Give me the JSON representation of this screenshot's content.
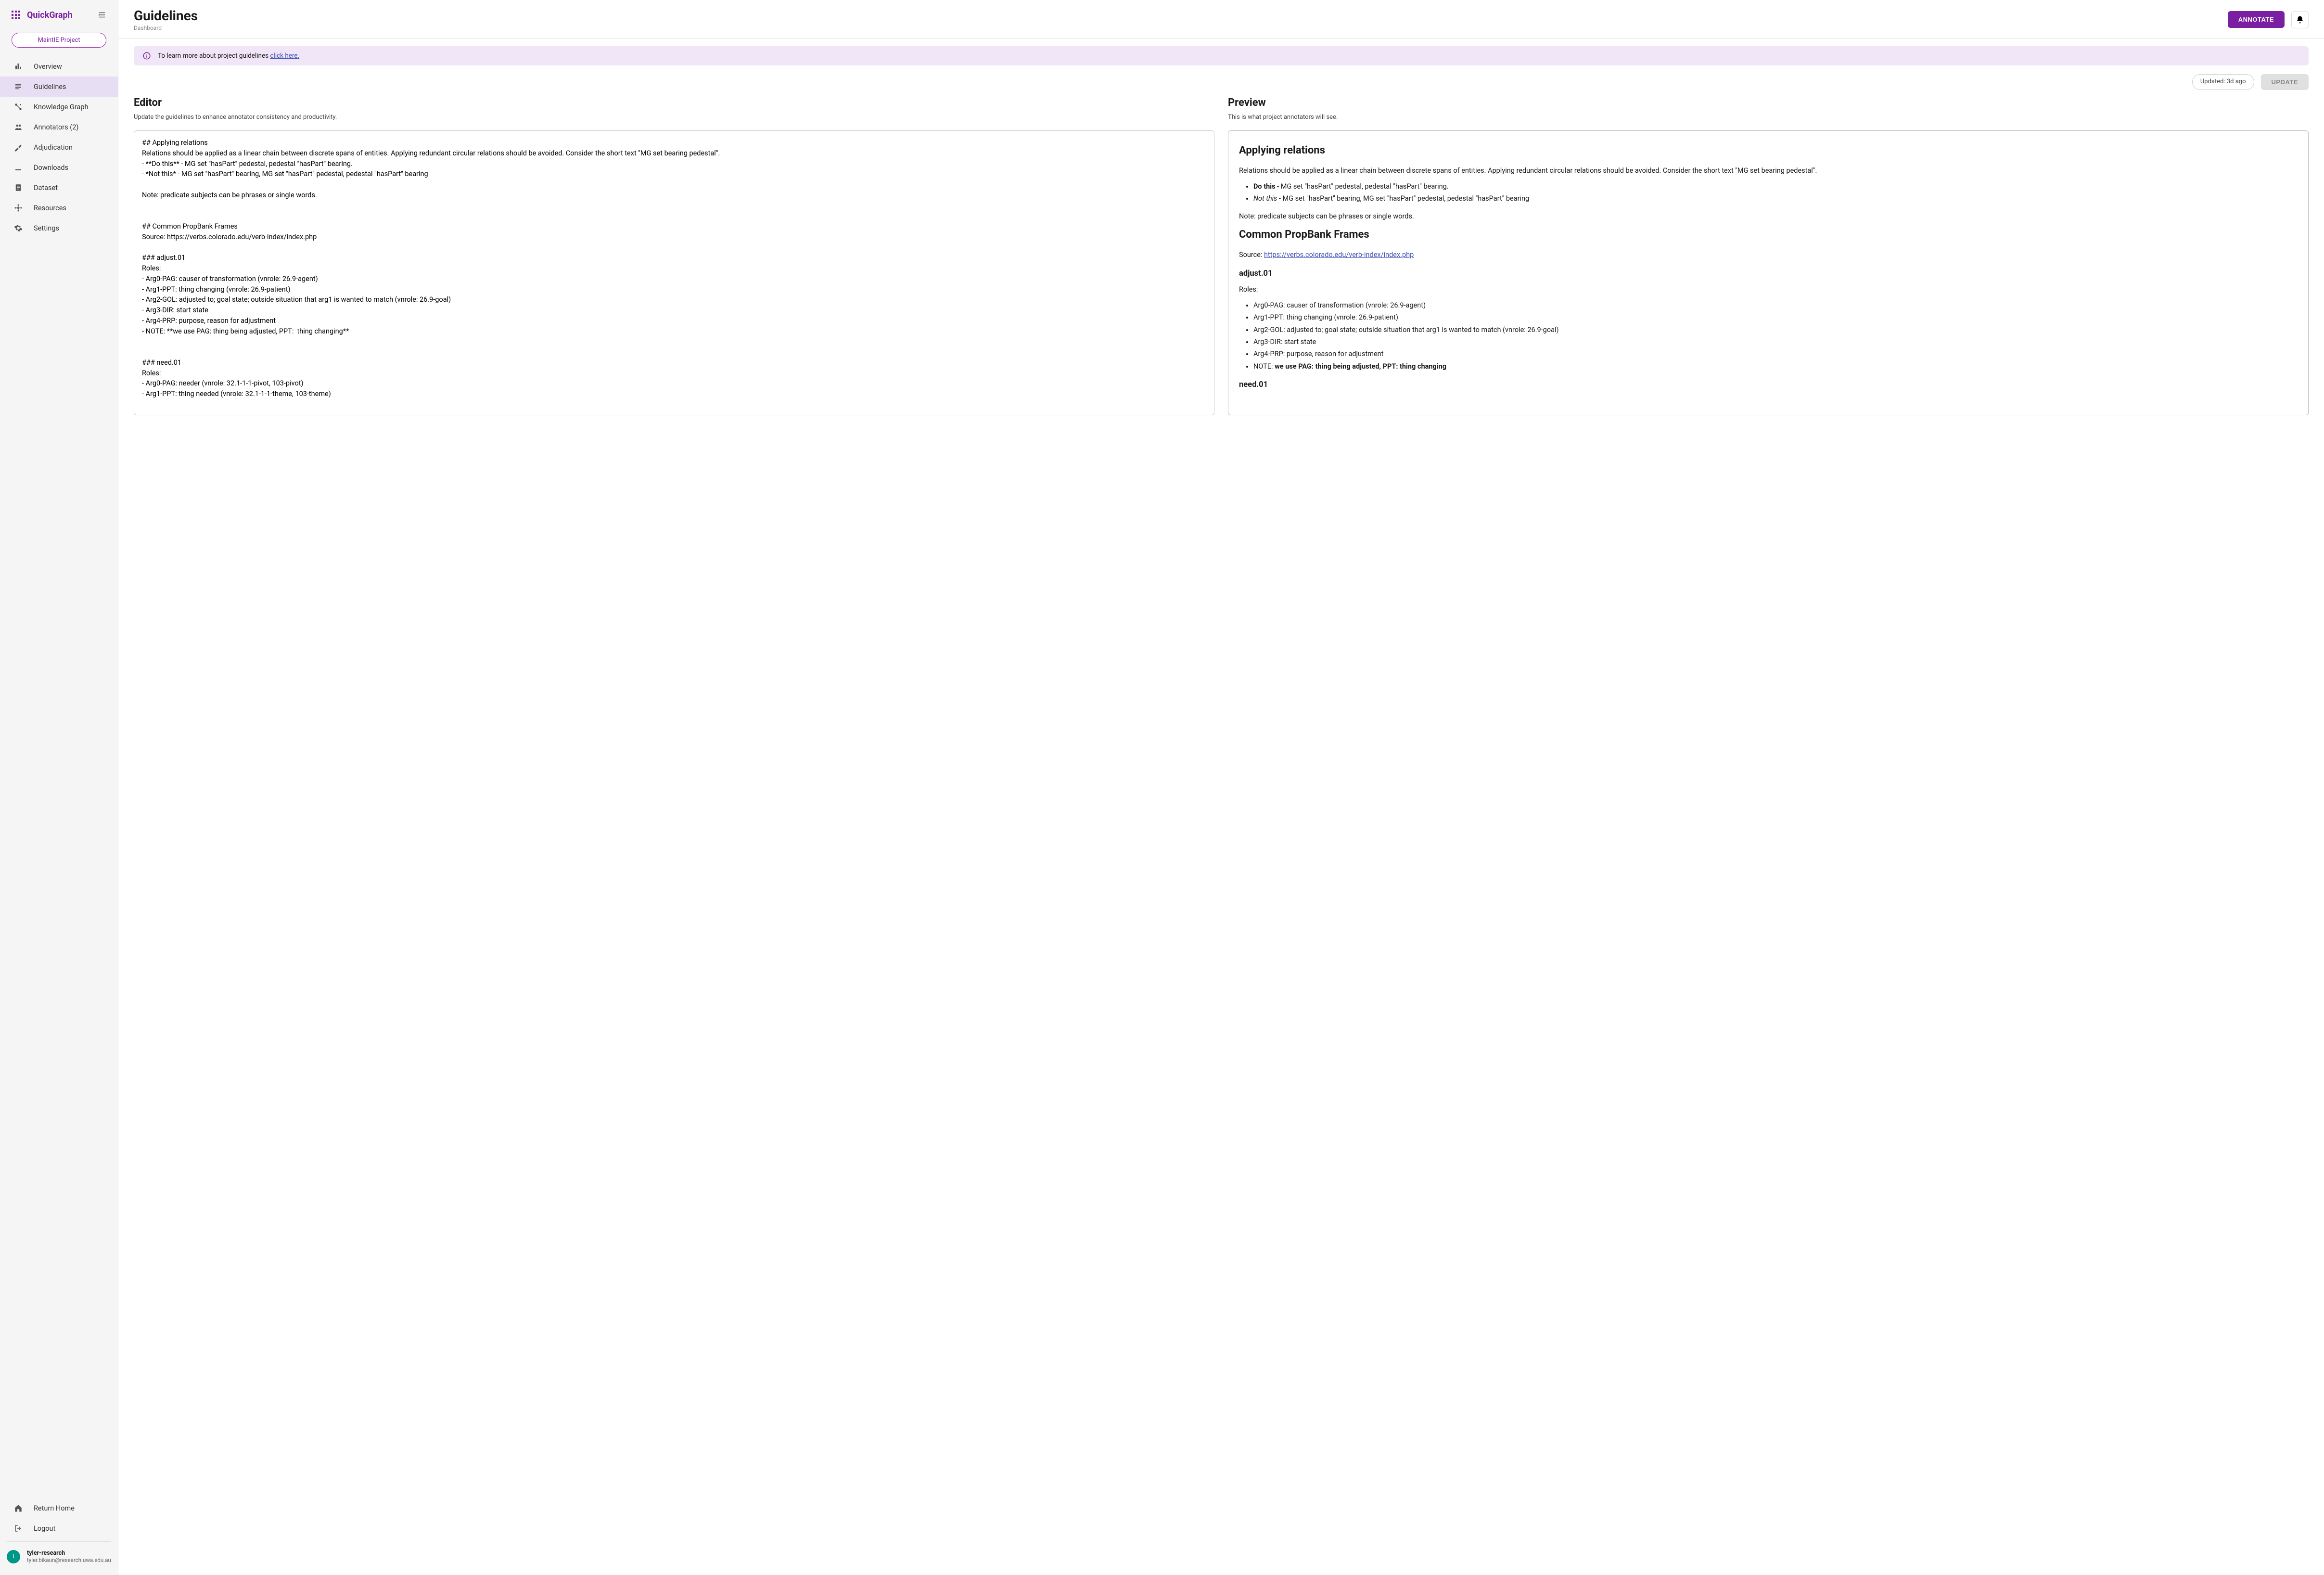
{
  "brand": "QuickGraph",
  "project": "MaintIE Project",
  "sidebar": {
    "items": [
      {
        "label": "Overview"
      },
      {
        "label": "Guidelines"
      },
      {
        "label": "Knowledge Graph"
      },
      {
        "label": "Annotators (2)"
      },
      {
        "label": "Adjudication"
      },
      {
        "label": "Downloads"
      },
      {
        "label": "Dataset"
      },
      {
        "label": "Resources"
      },
      {
        "label": "Settings"
      }
    ],
    "bottom": [
      {
        "label": "Return Home"
      },
      {
        "label": "Logout"
      }
    ]
  },
  "user": {
    "initial": "t",
    "name": "tyler-research",
    "email": "tyler.bikaun@research.uwa.edu.au"
  },
  "page": {
    "title": "Guidelines",
    "breadcrumb": "Dashboard"
  },
  "topbar": {
    "annotate": "ANNOTATE"
  },
  "banner": {
    "text": "To learn more about project guidelines ",
    "link": "click here."
  },
  "toolbar": {
    "updated": "Updated: 3d ago",
    "update_btn": "UPDATE"
  },
  "editor": {
    "heading": "Editor",
    "sub": "Update the guidelines to enhance annotator consistency and productivity.",
    "content": "## Applying relations\nRelations should be applied as a linear chain between discrete spans of entities. Applying redundant circular relations should be avoided. Consider the short text \"MG set bearing pedestal\".\n- **Do this** - MG set \"hasPart\" pedestal, pedestal \"hasPart\" bearing.\n- *Not this* - MG set \"hasPart\" bearing, MG set \"hasPart\" pedestal, pedestal \"hasPart\" bearing\n\nNote: predicate subjects can be phrases or single words.\n\n\n## Common PropBank Frames\nSource: https://verbs.colorado.edu/verb-index/index.php\n\n### adjust.01\nRoles:\n- Arg0-PAG: causer of transformation (vnrole: 26.9-agent)\n- Arg1-PPT: thing changing (vnrole: 26.9-patient)\n- Arg2-GOL: adjusted to; goal state; outside situation that arg1 is wanted to match (vnrole: 26.9-goal)\n- Arg3-DIR: start state\n- Arg4-PRP: purpose, reason for adjustment\n- NOTE: **we use PAG: thing being adjusted, PPT:  thing changing**\n\n\n### need.01\nRoles:\n- Arg0-PAG: needer (vnrole: 32.1-1-1-pivot, 103-pivot)\n- Arg1-PPT: thing needed (vnrole: 32.1-1-1-theme, 103-theme)"
  },
  "preview": {
    "heading": "Preview",
    "sub": "This is what project annotators will see.",
    "h_applying": "Applying relations",
    "p_applying": "Relations should be applied as a linear chain between discrete spans of entities. Applying redundant circular relations should be avoided. Consider the short text \"MG set bearing pedestal\".",
    "li1_bold": "Do this",
    "li1_rest": " - MG set \"hasPart\" pedestal, pedestal \"hasPart\" bearing.",
    "li2_italic": "Not this",
    "li2_rest": " - MG set \"hasPart\" bearing, MG set \"hasPart\" pedestal, pedestal \"hasPart\" bearing",
    "note1": "Note: predicate subjects can be phrases or single words.",
    "h_propbank": "Common PropBank Frames",
    "source_pre": "Source: ",
    "source_link": "https://verbs.colorado.edu/verb-index/index.php",
    "h_adjust": "adjust.01",
    "roles_label": "Roles:",
    "adjust_roles": [
      "Arg0-PAG: causer of transformation (vnrole: 26.9-agent)",
      "Arg1-PPT: thing changing (vnrole: 26.9-patient)",
      "Arg2-GOL: adjusted to; goal state; outside situation that arg1 is wanted to match (vnrole: 26.9-goal)",
      "Arg3-DIR: start state",
      "Arg4-PRP: purpose, reason for adjustment"
    ],
    "adjust_note_pre": "NOTE: ",
    "adjust_note_bold": "we use PAG: thing being adjusted, PPT: thing changing",
    "h_need": "need.01"
  }
}
